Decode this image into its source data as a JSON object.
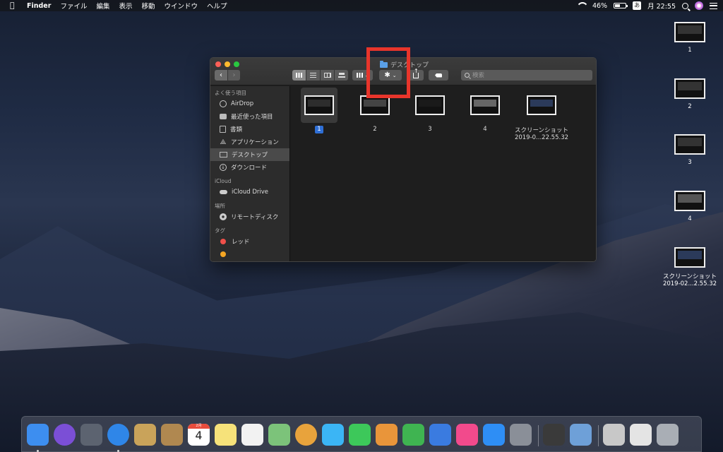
{
  "menubar": {
    "app_name": "Finder",
    "items": [
      "ファイル",
      "編集",
      "表示",
      "移動",
      "ウインドウ",
      "ヘルプ"
    ],
    "battery_percent": "46%",
    "battery_level": 0.46,
    "input_method": "あ",
    "clock": "月 22:55"
  },
  "desktop_items": [
    {
      "label": "1"
    },
    {
      "label": "2"
    },
    {
      "label": "3"
    },
    {
      "label": "4"
    },
    {
      "label_line1": "スクリーンショット",
      "label_line2": "2019-02...2.55.32"
    }
  ],
  "finder": {
    "title": "デスクトップ",
    "search_placeholder": "検索",
    "sidebar": {
      "favorites_header": "よく使う項目",
      "favorites": [
        {
          "label": "AirDrop",
          "icon": "airdrop-icon"
        },
        {
          "label": "最近使った項目",
          "icon": "recents-icon"
        },
        {
          "label": "書類",
          "icon": "documents-icon"
        },
        {
          "label": "アプリケーション",
          "icon": "applications-icon"
        },
        {
          "label": "デスクトップ",
          "icon": "desktop-icon",
          "selected": true
        },
        {
          "label": "ダウンロード",
          "icon": "downloads-icon"
        }
      ],
      "icloud_header": "iCloud",
      "icloud": [
        {
          "label": "iCloud Drive",
          "icon": "cloud-icon"
        }
      ],
      "locations_header": "場所",
      "locations": [
        {
          "label": "リモートディスク",
          "icon": "disc-icon"
        }
      ],
      "tags_header": "タグ",
      "tags": [
        {
          "label": "レッド",
          "color": "#f0504a"
        },
        {
          "label": "",
          "color": "#f5a623"
        }
      ]
    },
    "files": [
      {
        "label": "1",
        "selected": true
      },
      {
        "label": "2"
      },
      {
        "label": "3"
      },
      {
        "label": "4"
      },
      {
        "label_line1": "スクリーンショット",
        "label_line2": "2019-0...22.55.32"
      }
    ]
  },
  "dock_apps": [
    {
      "name": "finder-icon",
      "color": "#3d8ef0"
    },
    {
      "name": "siri-icon",
      "color": "#7b4fd6"
    },
    {
      "name": "launchpad-icon",
      "color": "#5c6370"
    },
    {
      "name": "safari-icon",
      "color": "#2f86e8"
    },
    {
      "name": "mail-stamp-icon",
      "color": "#c9a35a"
    },
    {
      "name": "contacts-icon",
      "color": "#b08850"
    },
    {
      "name": "calendar-icon",
      "color": "#ffffff"
    },
    {
      "name": "notes-icon",
      "color": "#f6e27a"
    },
    {
      "name": "reminders-icon",
      "color": "#f2f2f2"
    },
    {
      "name": "maps-icon",
      "color": "#7cc37a"
    },
    {
      "name": "photos-icon",
      "color": "#e8a33c"
    },
    {
      "name": "messages-icon",
      "color": "#3bb5f5"
    },
    {
      "name": "facetime-icon",
      "color": "#3dc85a"
    },
    {
      "name": "keynote-presentation-icon",
      "color": "#e9953a"
    },
    {
      "name": "numbers-icon",
      "color": "#3fb451"
    },
    {
      "name": "keynote-icon",
      "color": "#3a7be0"
    },
    {
      "name": "itunes-icon",
      "color": "#f24a8c"
    },
    {
      "name": "app-store-icon",
      "color": "#2e8ef5"
    },
    {
      "name": "system-preferences-icon",
      "color": "#8a8f98"
    },
    {
      "name": "final-cut-icon",
      "color": "#3a3a3a"
    },
    {
      "name": "preview-icon",
      "color": "#6ea0d8"
    },
    {
      "name": "ipad-icon",
      "color": "#c8c8c8"
    },
    {
      "name": "mail-document-icon",
      "color": "#e4e4e4"
    },
    {
      "name": "trash-icon",
      "color": "#a9aeb5"
    }
  ],
  "calendar_day": "4",
  "calendar_month": "2月"
}
